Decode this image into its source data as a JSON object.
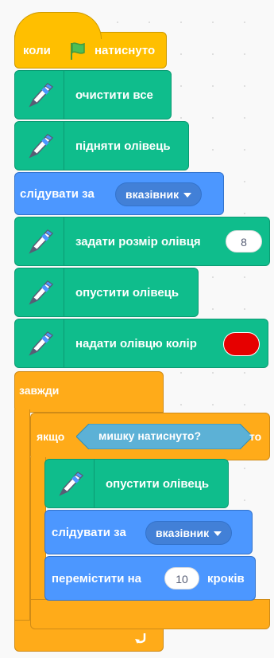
{
  "script": {
    "hat": {
      "prefix": "коли",
      "suffix": "натиснуто",
      "icon": "green-flag-icon"
    },
    "clear": {
      "label": "очистити все",
      "icon": "pen-icon"
    },
    "pen_up": {
      "label": "підняти олівець",
      "icon": "pen-icon"
    },
    "goto1": {
      "label": "слідувати за",
      "target": "вказівник"
    },
    "set_size": {
      "label": "задати розмір олівця",
      "value": "8",
      "icon": "pen-icon"
    },
    "pen_down1": {
      "label": "опустити олівець",
      "icon": "pen-icon"
    },
    "set_color": {
      "label": "надати олівцю колір",
      "color": "#e60000",
      "icon": "pen-icon"
    },
    "forever": {
      "label": "завжди",
      "icon": "loop-arrow-icon"
    },
    "if_block": {
      "prefix": "якщо",
      "condition": "мишку натиснуто?",
      "suffix": "то"
    },
    "pen_down2": {
      "label": "опустити олівець",
      "icon": "pen-icon"
    },
    "goto2": {
      "label": "слідувати за",
      "target": "вказівник"
    },
    "move": {
      "prefix": "перемістити на",
      "value": "10",
      "suffix": "кроків"
    }
  },
  "colors": {
    "pen": "#0fbd8c",
    "motion": "#4c97ff",
    "control": "#ffab19",
    "events": "#ffbf00",
    "sensing": "#5cb1d6"
  }
}
